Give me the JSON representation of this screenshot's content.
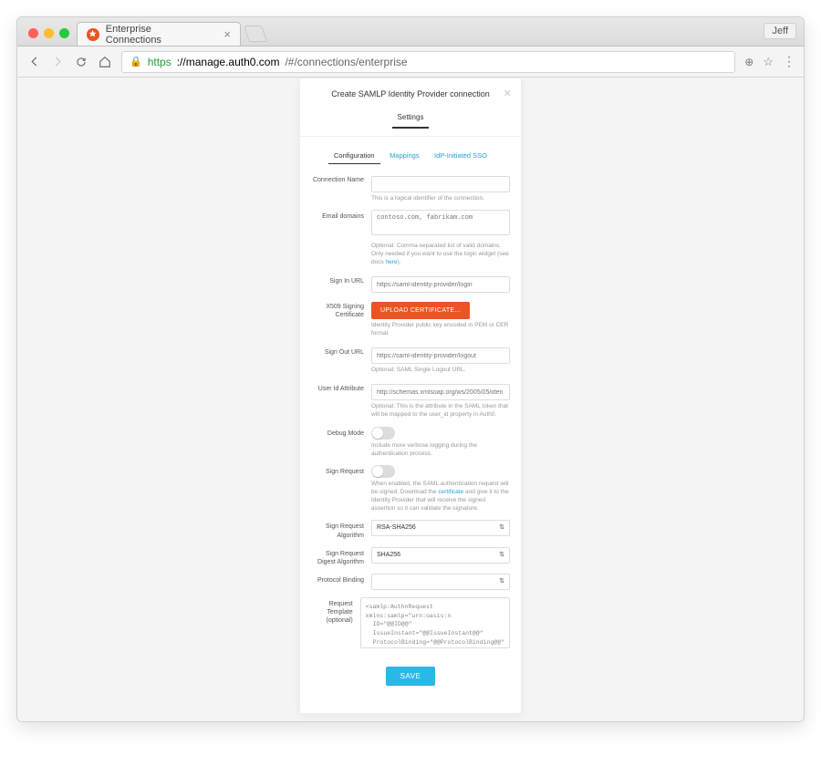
{
  "browser": {
    "tab_title": "Enterprise Connections",
    "user_badge": "Jeff",
    "url_scheme": "https",
    "url_host": "://manage.auth0.com",
    "url_path": "/#/connections/enterprise"
  },
  "modal": {
    "title": "Create SAMLP Identity Provider connection",
    "subtab": "Settings",
    "inner_tabs": {
      "config": "Configuration",
      "mappings": "Mappings",
      "idp": "IdP-Initiated SSO"
    }
  },
  "form": {
    "conn_name": {
      "label": "Connection Name",
      "help": "This is a logical identifier of the connection."
    },
    "email_domains": {
      "label": "Email domains",
      "placeholder": "contoso.com, fabrikam.com",
      "help_pre": "Optional: Comma-separated list of valid domains. Only needed if you want to use the login widget (see docs ",
      "help_link": "here",
      "help_post": ")."
    },
    "signin": {
      "label": "Sign In URL",
      "placeholder": "https://saml-identity-provider/login"
    },
    "x509": {
      "label": "X509 Signing Certificate",
      "button": "UPLOAD CERTIFICATE...",
      "help": "Identity Provider public key encoded in PEM or CER format"
    },
    "signout": {
      "label": "Sign Out URL",
      "placeholder": "https://saml-identity-provider/logout",
      "help": "Optional: SAML Single Logout URL."
    },
    "userid": {
      "label": "User Id Attribute",
      "placeholder": "http://schemas.xmlsoap.org/ws/2005/05/iden",
      "help": "Optional: This is the attribute in the SAML token that will be mapped to the user_id property in Auth0."
    },
    "debug": {
      "label": "Debug Mode",
      "help": "Include more verbose logging during the authentication process."
    },
    "signreq": {
      "label": "Sign Request",
      "help_pre": "When enabled, the SAML authentication request will be signed. Download the ",
      "help_link": "certificate",
      "help_post": " and give it to the Identity Provider that will receive the signed assertion so it can validate the signature."
    },
    "algo": {
      "label": "Sign Request Algorithm",
      "value": "RSA-SHA256"
    },
    "digest": {
      "label": "Sign Request Digest Algorithm",
      "value": "SHA256"
    },
    "binding": {
      "label": "Protocol Binding",
      "value": ""
    },
    "template": {
      "label": "Request Template (optional)",
      "line1": "<samlp:AuthnRequest xmlns:samlp=\"urn:oasis:n",
      "line2": "ID=\"@@ID@@\"",
      "line3": "IssueInstant=\"@@IssueInstant@@\"",
      "line4": "ProtocolBinding=\"@@ProtocolBinding@@\" V"
    },
    "save": "SAVE"
  }
}
